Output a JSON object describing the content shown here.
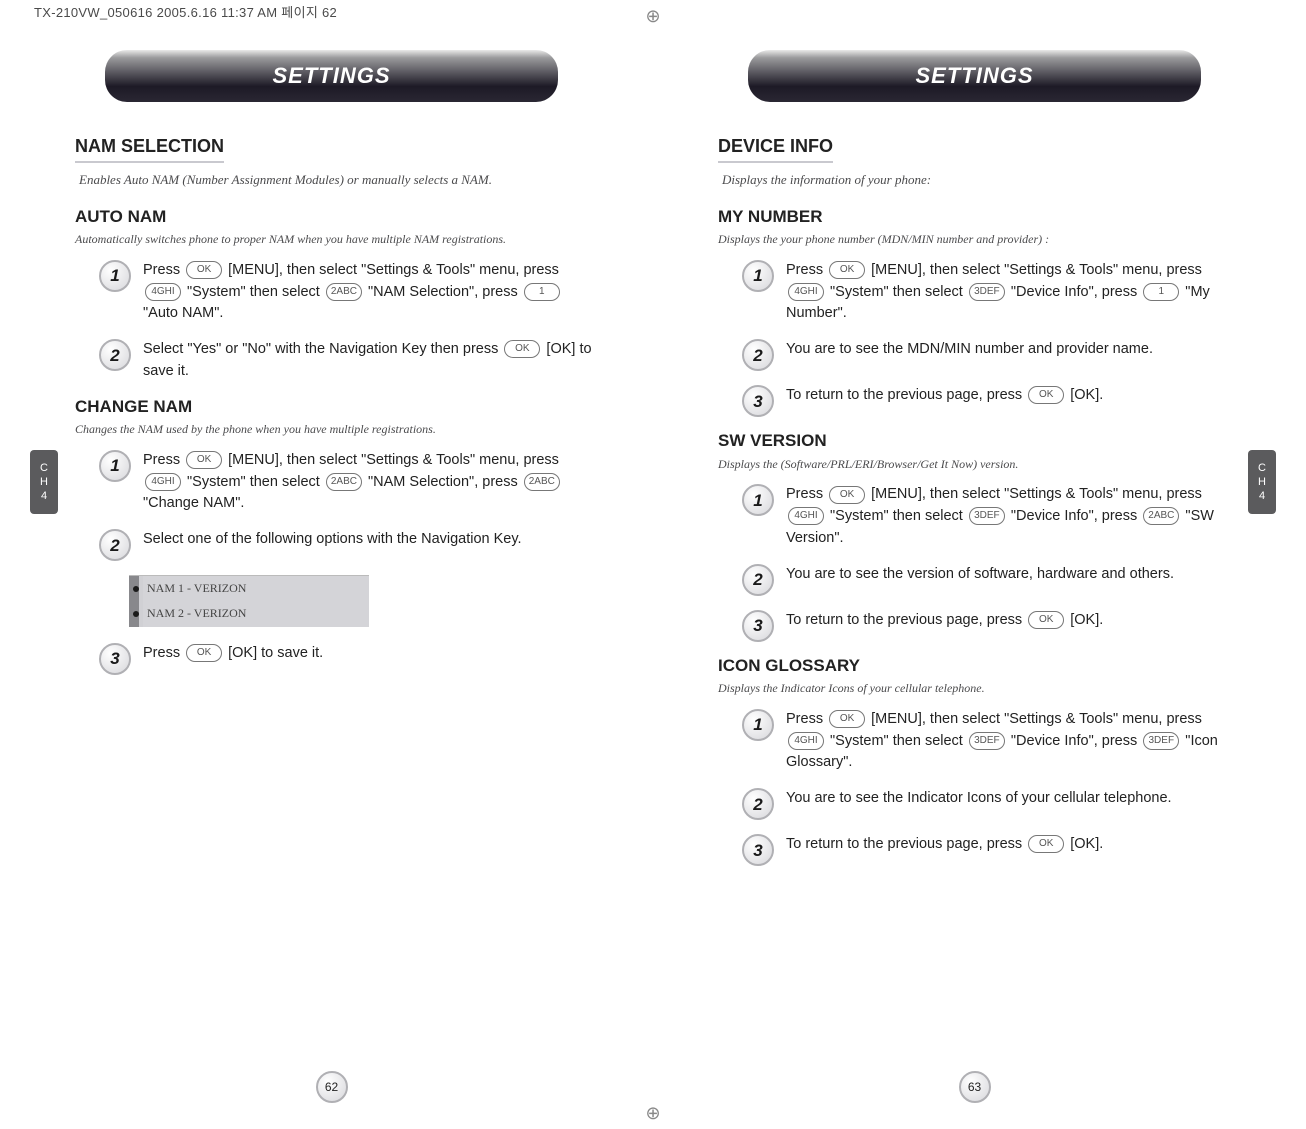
{
  "meta_top": "TX-210VW_050616  2005.6.16 11:37 AM  페이지 62",
  "left": {
    "header": "SETTINGS",
    "ch_tab": {
      "top": "C",
      "mid": "H",
      "bot": "4"
    },
    "section_title": "NAM SELECTION",
    "section_desc": "Enables Auto NAM (Number Assignment Modules) or manually selects a NAM.",
    "auto": {
      "title": "AUTO NAM",
      "desc": "Automatically switches phone to proper NAM when you have multiple NAM registrations.",
      "step1_pre": "Press ",
      "step1_k1": "OK",
      "step1_mid1": " [MENU], then select \"Settings & Tools\" menu, press ",
      "step1_k2": "4GHI",
      "step1_mid2": " \"System\" then select ",
      "step1_k3": "2ABC",
      "step1_mid3": " \"NAM Selection\", press ",
      "step1_k4": "1",
      "step1_end": " \"Auto NAM\".",
      "step2": "Select \"Yes\" or \"No\" with the Navigation Key then press ",
      "step2_k": "OK",
      "step2_end": " [OK] to save it."
    },
    "change": {
      "title": "CHANGE NAM",
      "desc": "Changes the NAM used by the phone when you have multiple registrations.",
      "step1_pre": "Press ",
      "step1_k1": "OK",
      "step1_mid1": " [MENU], then select \"Settings & Tools\" menu, press ",
      "step1_k2": "4GHI",
      "step1_mid2": " \"System\" then select ",
      "step1_k3": "2ABC",
      "step1_mid3": " \"NAM Selection\", press ",
      "step1_k4": "2ABC",
      "step1_end": " \"Change NAM\".",
      "step2": "Select one of the following options with the Navigation Key.",
      "options": [
        "NAM 1 - VERIZON",
        "NAM 2 - VERIZON"
      ],
      "step3_pre": "Press ",
      "step3_k": "OK",
      "step3_end": " [OK] to save it."
    },
    "page_num": "62"
  },
  "right": {
    "header": "SETTINGS",
    "ch_tab": {
      "top": "C",
      "mid": "H",
      "bot": "4"
    },
    "section_title": "DEVICE INFO",
    "section_desc": "Displays the information of your phone:",
    "mynumber": {
      "title": "MY NUMBER",
      "desc": "Displays the your phone number (MDN/MIN number and provider) :",
      "step1_pre": "Press ",
      "step1_k1": "OK",
      "step1_mid1": " [MENU], then select \"Settings & Tools\" menu, press ",
      "step1_k2": "4GHI",
      "step1_mid2": " \"System\" then select ",
      "step1_k3": "3DEF",
      "step1_mid3": " \"Device Info\", press ",
      "step1_k4": "1",
      "step1_end": " \"My Number\".",
      "step2": "You are to see the MDN/MIN number and provider name.",
      "step3_pre": "To return to the previous page, press ",
      "step3_k": "OK",
      "step3_end": " [OK]."
    },
    "swver": {
      "title": "SW VERSION",
      "desc": "Displays the (Software/PRL/ERI/Browser/Get It Now) version.",
      "step1_pre": "Press ",
      "step1_k1": "OK",
      "step1_mid1": " [MENU], then select \"Settings & Tools\" menu, press ",
      "step1_k2": "4GHI",
      "step1_mid2": " \"System\" then select ",
      "step1_k3": "3DEF",
      "step1_mid3": " \"Device Info\", press ",
      "step1_k4": "2ABC",
      "step1_end": " \"SW Version\".",
      "step2": "You are to see the version of software, hardware and others.",
      "step3_pre": "To return to the previous page, press ",
      "step3_k": "OK",
      "step3_end": " [OK]."
    },
    "iconglossary": {
      "title": "ICON GLOSSARY",
      "desc": "Displays the Indicator Icons of your cellular telephone.",
      "step1_pre": "Press ",
      "step1_k1": "OK",
      "step1_mid1": " [MENU], then select \"Settings & Tools\" menu, press ",
      "step1_k2": "4GHI",
      "step1_mid2": " \"System\" then select ",
      "step1_k3": "3DEF",
      "step1_mid3": " \"Device Info\", press ",
      "step1_k4": "3DEF",
      "step1_end": " \"Icon Glossary\".",
      "step2": "You are to see the Indicator Icons of your cellular telephone.",
      "step3_pre": "To return to the previous page, press ",
      "step3_k": "OK",
      "step3_end": " [OK]."
    },
    "page_num": "63"
  }
}
